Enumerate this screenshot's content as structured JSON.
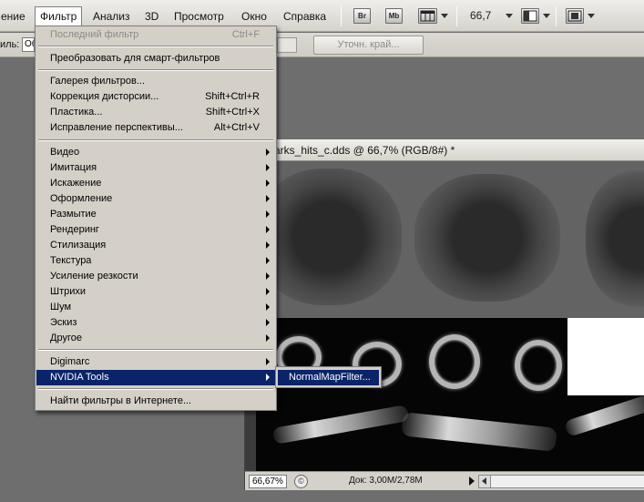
{
  "menubar": {
    "items": [
      {
        "label": "ение"
      },
      {
        "label": "Фильтр"
      },
      {
        "label": "Анализ"
      },
      {
        "label": "3D"
      },
      {
        "label": "Просмотр"
      },
      {
        "label": "Окно"
      },
      {
        "label": "Справка"
      }
    ],
    "bridge_label": "Br",
    "minibridge_label": "Mb",
    "zoom": "66,7"
  },
  "options": {
    "style_label": "иль:",
    "style_value": "Об",
    "refine_edge_label": "Уточн. край..."
  },
  "filter_menu": {
    "last_filter": {
      "label": "Последний фильтр",
      "shortcut": "Ctrl+F"
    },
    "convert_smart": "Преобразовать для смарт-фильтров",
    "group1": [
      {
        "label": "Галерея фильтров...",
        "shortcut": ""
      },
      {
        "label": "Коррекция дисторсии...",
        "shortcut": "Shift+Ctrl+R"
      },
      {
        "label": "Пластика...",
        "shortcut": "Shift+Ctrl+X"
      },
      {
        "label": "Исправление перспективы...",
        "shortcut": "Alt+Ctrl+V"
      }
    ],
    "submenus": [
      {
        "label": "Видео"
      },
      {
        "label": "Имитация"
      },
      {
        "label": "Искажение"
      },
      {
        "label": "Оформление"
      },
      {
        "label": "Размытие"
      },
      {
        "label": "Рендеринг"
      },
      {
        "label": "Стилизация"
      },
      {
        "label": "Текстура"
      },
      {
        "label": "Усиление резкости"
      },
      {
        "label": "Штрихи"
      },
      {
        "label": "Шум"
      },
      {
        "label": "Эскиз"
      },
      {
        "label": "Другое"
      }
    ],
    "plugins": [
      {
        "label": "Digimarc"
      },
      {
        "label": "NVIDIA Tools"
      }
    ],
    "find_online": "Найти фильтры в Интернете..."
  },
  "nvidia_submenu": {
    "item": "NormalMapFilter..."
  },
  "document": {
    "title": "arks_hits_c.dds @ 66,7% (RGB/8#) *",
    "zoom": "66,67%",
    "doc_info": "Док: 3,00M/2,78M"
  },
  "colors": {
    "menu_bg": "#d4d0c8",
    "highlight": "#0a246a",
    "workspace": "#6e6e6e"
  }
}
